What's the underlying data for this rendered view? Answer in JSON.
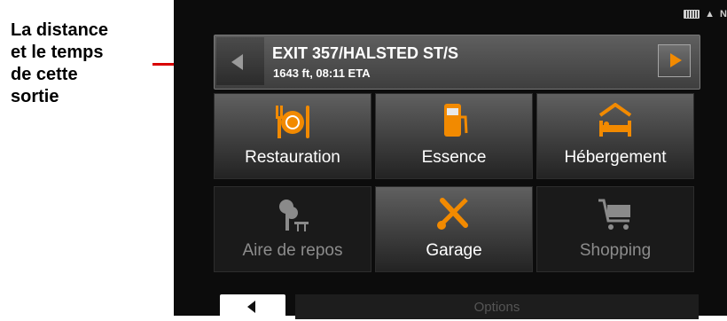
{
  "annotation": {
    "lines": [
      "La distance",
      "et le temps",
      "de cette",
      "sortie"
    ]
  },
  "status": {
    "icons": [
      "battery-icon",
      "warning-icon",
      "signal-icon"
    ],
    "warning_glyph": "▲",
    "signal_glyph": "N"
  },
  "exit": {
    "title": "EXIT 357/HALSTED ST/S",
    "detail": "1643 ft, 08:11 ETA"
  },
  "categories": [
    {
      "label": "Restauration",
      "icon": "restaurant-icon",
      "enabled": true
    },
    {
      "label": "Essence",
      "icon": "fuel-icon",
      "enabled": true
    },
    {
      "label": "Hébergement",
      "icon": "lodging-icon",
      "enabled": true
    },
    {
      "label": "Aire de repos",
      "icon": "rest-area-icon",
      "enabled": false
    },
    {
      "label": "Garage",
      "icon": "garage-icon",
      "enabled": true
    },
    {
      "label": "Shopping",
      "icon": "shopping-icon",
      "enabled": false
    }
  ],
  "footer": {
    "options_label": "Options"
  },
  "colors": {
    "accent": "#f28a00",
    "callout_line": "#d80000"
  }
}
